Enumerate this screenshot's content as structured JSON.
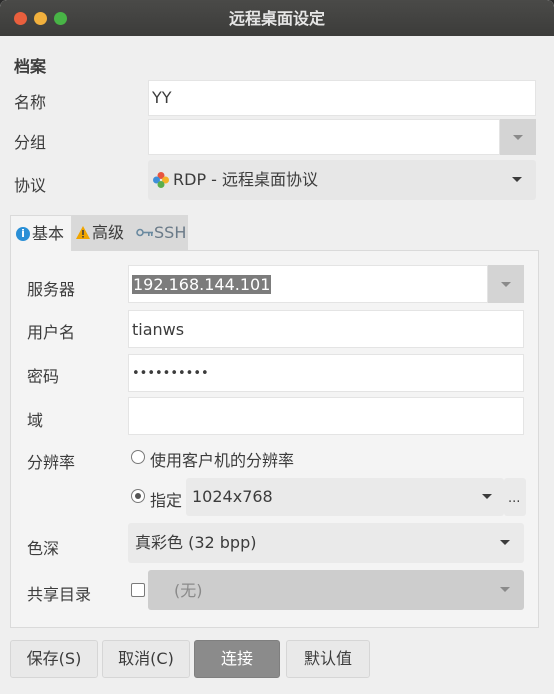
{
  "window": {
    "title": "远程桌面设定"
  },
  "profile": {
    "section_label": "档案",
    "name_label": "名称",
    "name_value": "YY",
    "group_label": "分组",
    "group_value": "",
    "protocol_label": "协议",
    "protocol_value": "RDP - 远程桌面协议"
  },
  "tabs": [
    {
      "label": "基本",
      "icon": "info-icon",
      "selected": true
    },
    {
      "label": "高级",
      "icon": "warning-icon",
      "selected": false
    },
    {
      "label": "SSH",
      "icon": "key-icon",
      "selected": false
    }
  ],
  "basic": {
    "server_label": "服务器",
    "server_value": "192.168.144.101",
    "username_label": "用户名",
    "username_value": "tianws",
    "password_label": "密码",
    "password_value": "••••••••••",
    "domain_label": "域",
    "domain_value": "",
    "resolution_label": "分辨率",
    "resolution_option_client": "使用客户机的分辨率",
    "resolution_option_custom": "指定",
    "resolution_value": "1024x768",
    "resolution_more": "...",
    "color_depth_label": "色深",
    "color_depth_value": "真彩色 (32 bpp)",
    "shared_folder_label": "共享目录",
    "shared_folder_value": "(无)"
  },
  "buttons": {
    "save": "保存(S)",
    "cancel": "取消(C)",
    "connect": "连接",
    "default": "默认值"
  },
  "colors": {
    "titlebar": "#3c3c3a",
    "close": "#e95f3d",
    "minimize": "#f1b03d",
    "maximize": "#48b446",
    "info_icon": "#2a8fd6",
    "warning_icon": "#f0a500"
  }
}
